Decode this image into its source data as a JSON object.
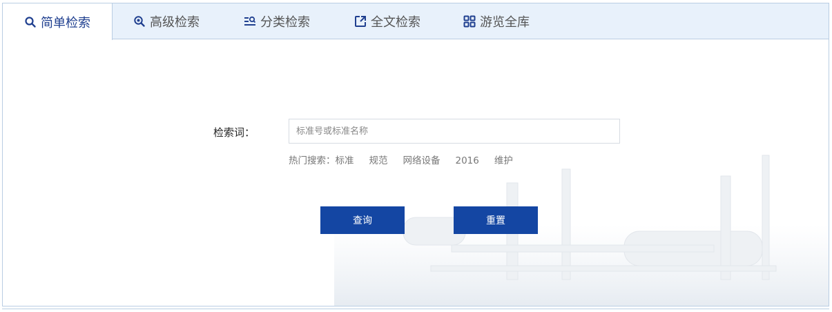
{
  "tabs": [
    {
      "label": "简单检索",
      "icon": "search-icon",
      "active": true
    },
    {
      "label": "高级检索",
      "icon": "advanced-search-icon",
      "active": false
    },
    {
      "label": "分类检索",
      "icon": "category-search-icon",
      "active": false
    },
    {
      "label": "全文检索",
      "icon": "fulltext-search-icon",
      "active": false
    },
    {
      "label": "游览全库",
      "icon": "grid-icon",
      "active": false
    }
  ],
  "form": {
    "label": "检索词：",
    "placeholder": "标准号或标准名称",
    "value": ""
  },
  "hot_search": {
    "prefix": "热门搜索：",
    "items": [
      "标准",
      "规范",
      "网络设备",
      "2016",
      "维护"
    ]
  },
  "buttons": {
    "query": "查询",
    "reset": "重置"
  },
  "colors": {
    "accent": "#1446a3",
    "active_tab_text": "#1f3f8f",
    "tabbar_bg": "#e8f1fb",
    "border": "#b9cde3"
  }
}
